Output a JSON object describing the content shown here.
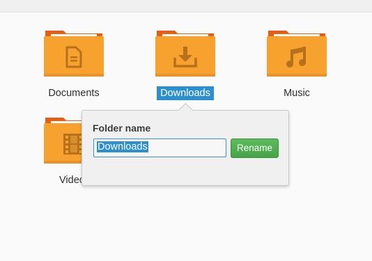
{
  "folders": [
    {
      "label": "Documents",
      "icon": "document-icon"
    },
    {
      "label": "Downloads",
      "icon": "download-icon"
    },
    {
      "label": "Music",
      "icon": "music-note-icon"
    },
    {
      "label": "Video",
      "icon": "film-icon"
    }
  ],
  "rename_popover": {
    "title": "Folder name",
    "input_value": "Downloads",
    "button_label": "Rename"
  },
  "colors": {
    "folder_body": "#f7a22e",
    "folder_tab": "#e85d12",
    "folder_glyph": "#b7701b",
    "selection": "#2e8fce",
    "rename_button": "#4caf50"
  }
}
